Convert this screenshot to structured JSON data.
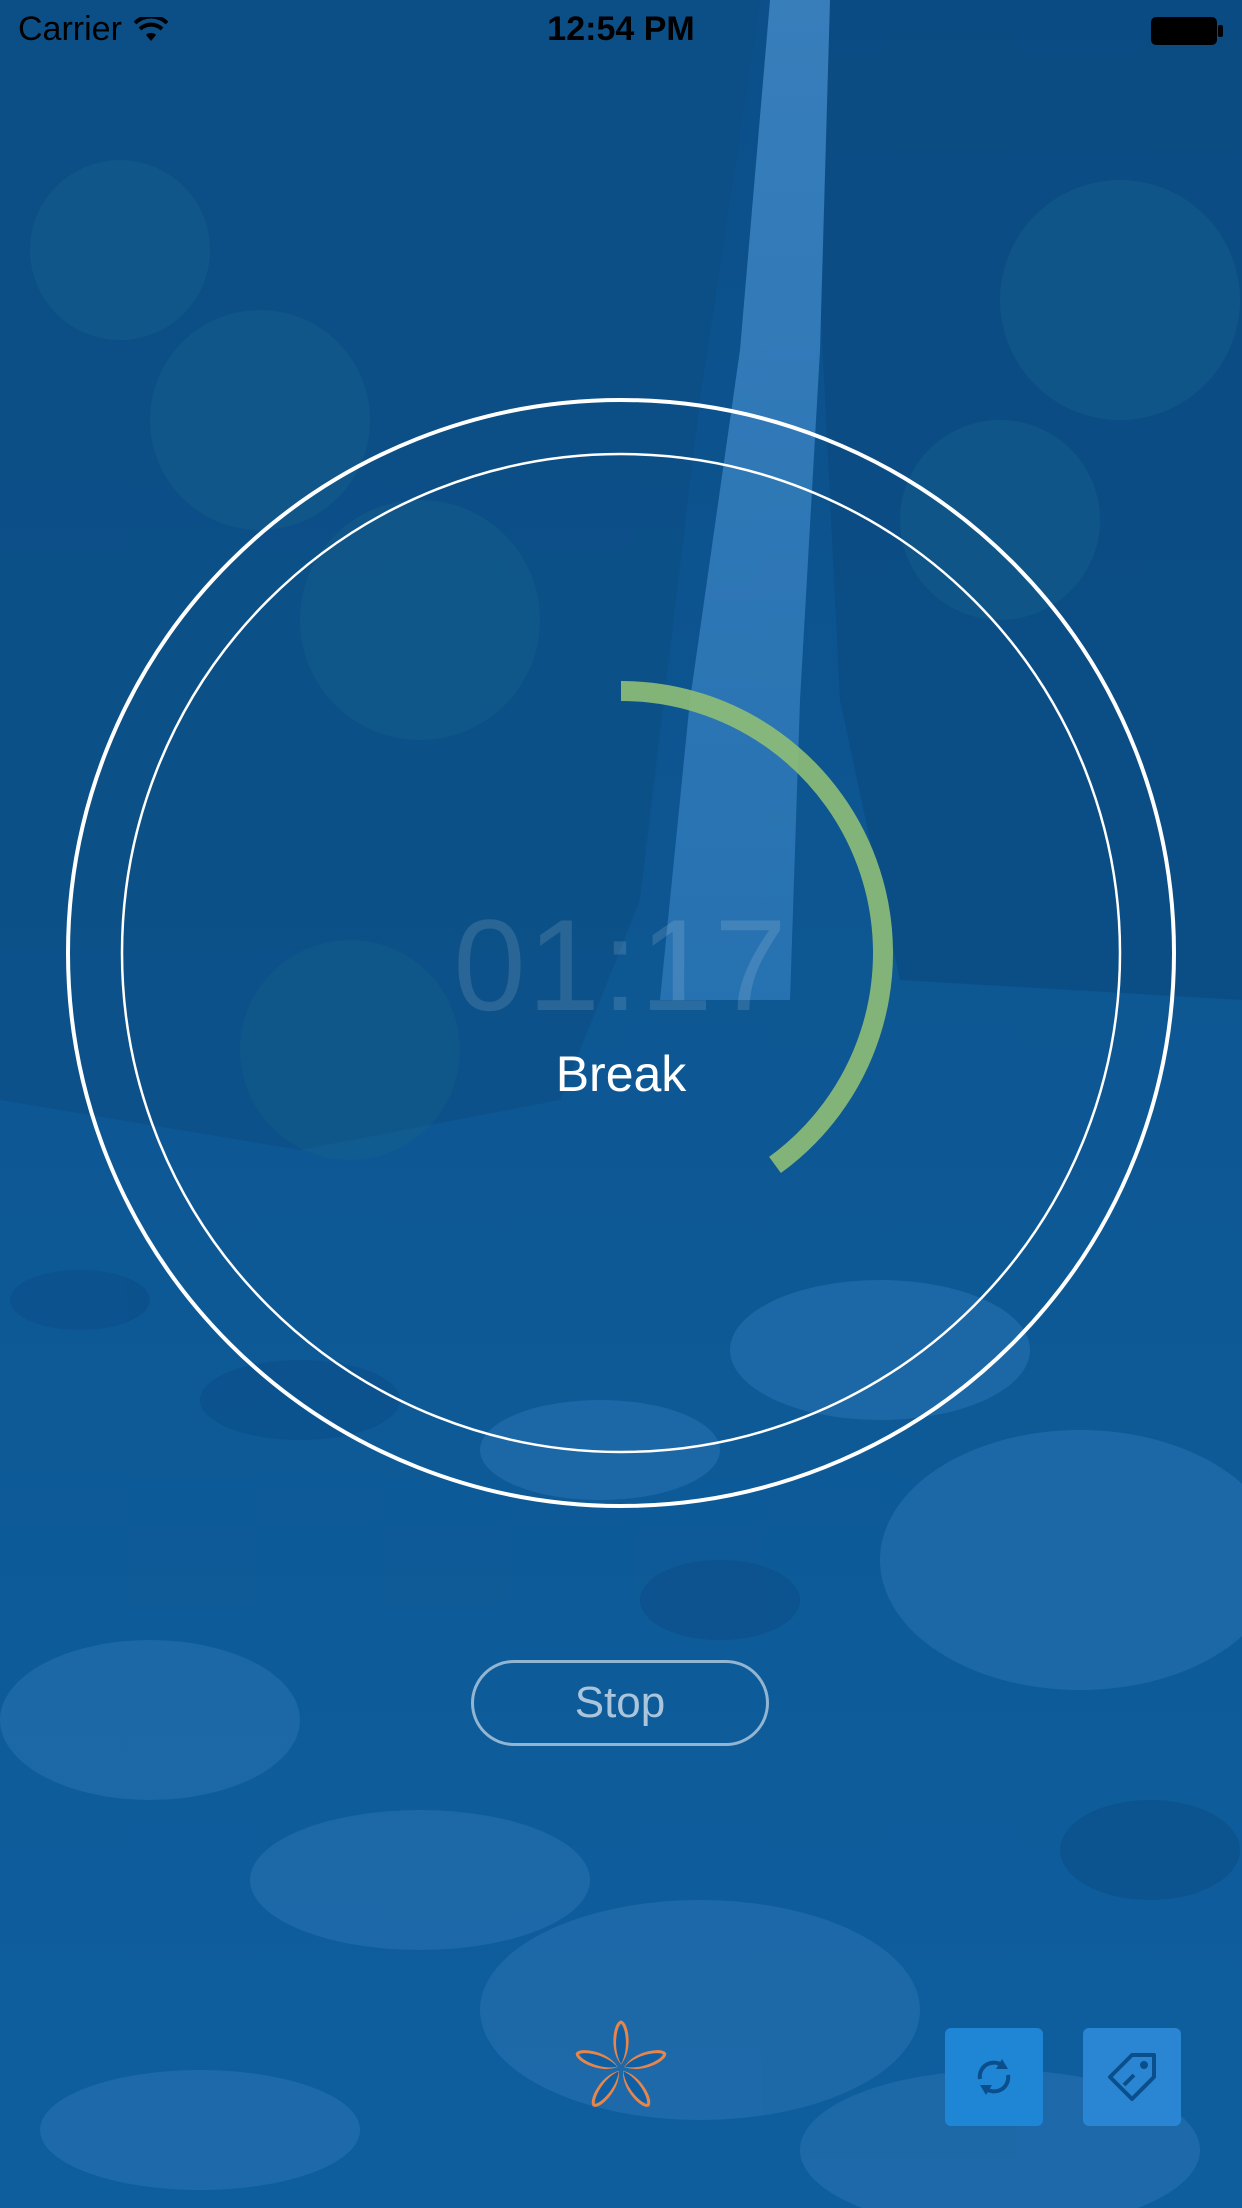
{
  "status_bar": {
    "carrier": "Carrier",
    "time": "12:54 PM"
  },
  "timer": {
    "time": "01:17",
    "mode": "Break",
    "progress_fraction": 0.4,
    "progress_color": "#8fbf77"
  },
  "controls": {
    "stop_label": "Stop"
  },
  "icons": {
    "logo": "flower-logo-icon",
    "repeat": "repeat-icon",
    "tag": "tag-icon"
  },
  "colors": {
    "overlay": "#0a5aa0",
    "ring": "#ffffff",
    "logo_accent": "#e8864a"
  }
}
